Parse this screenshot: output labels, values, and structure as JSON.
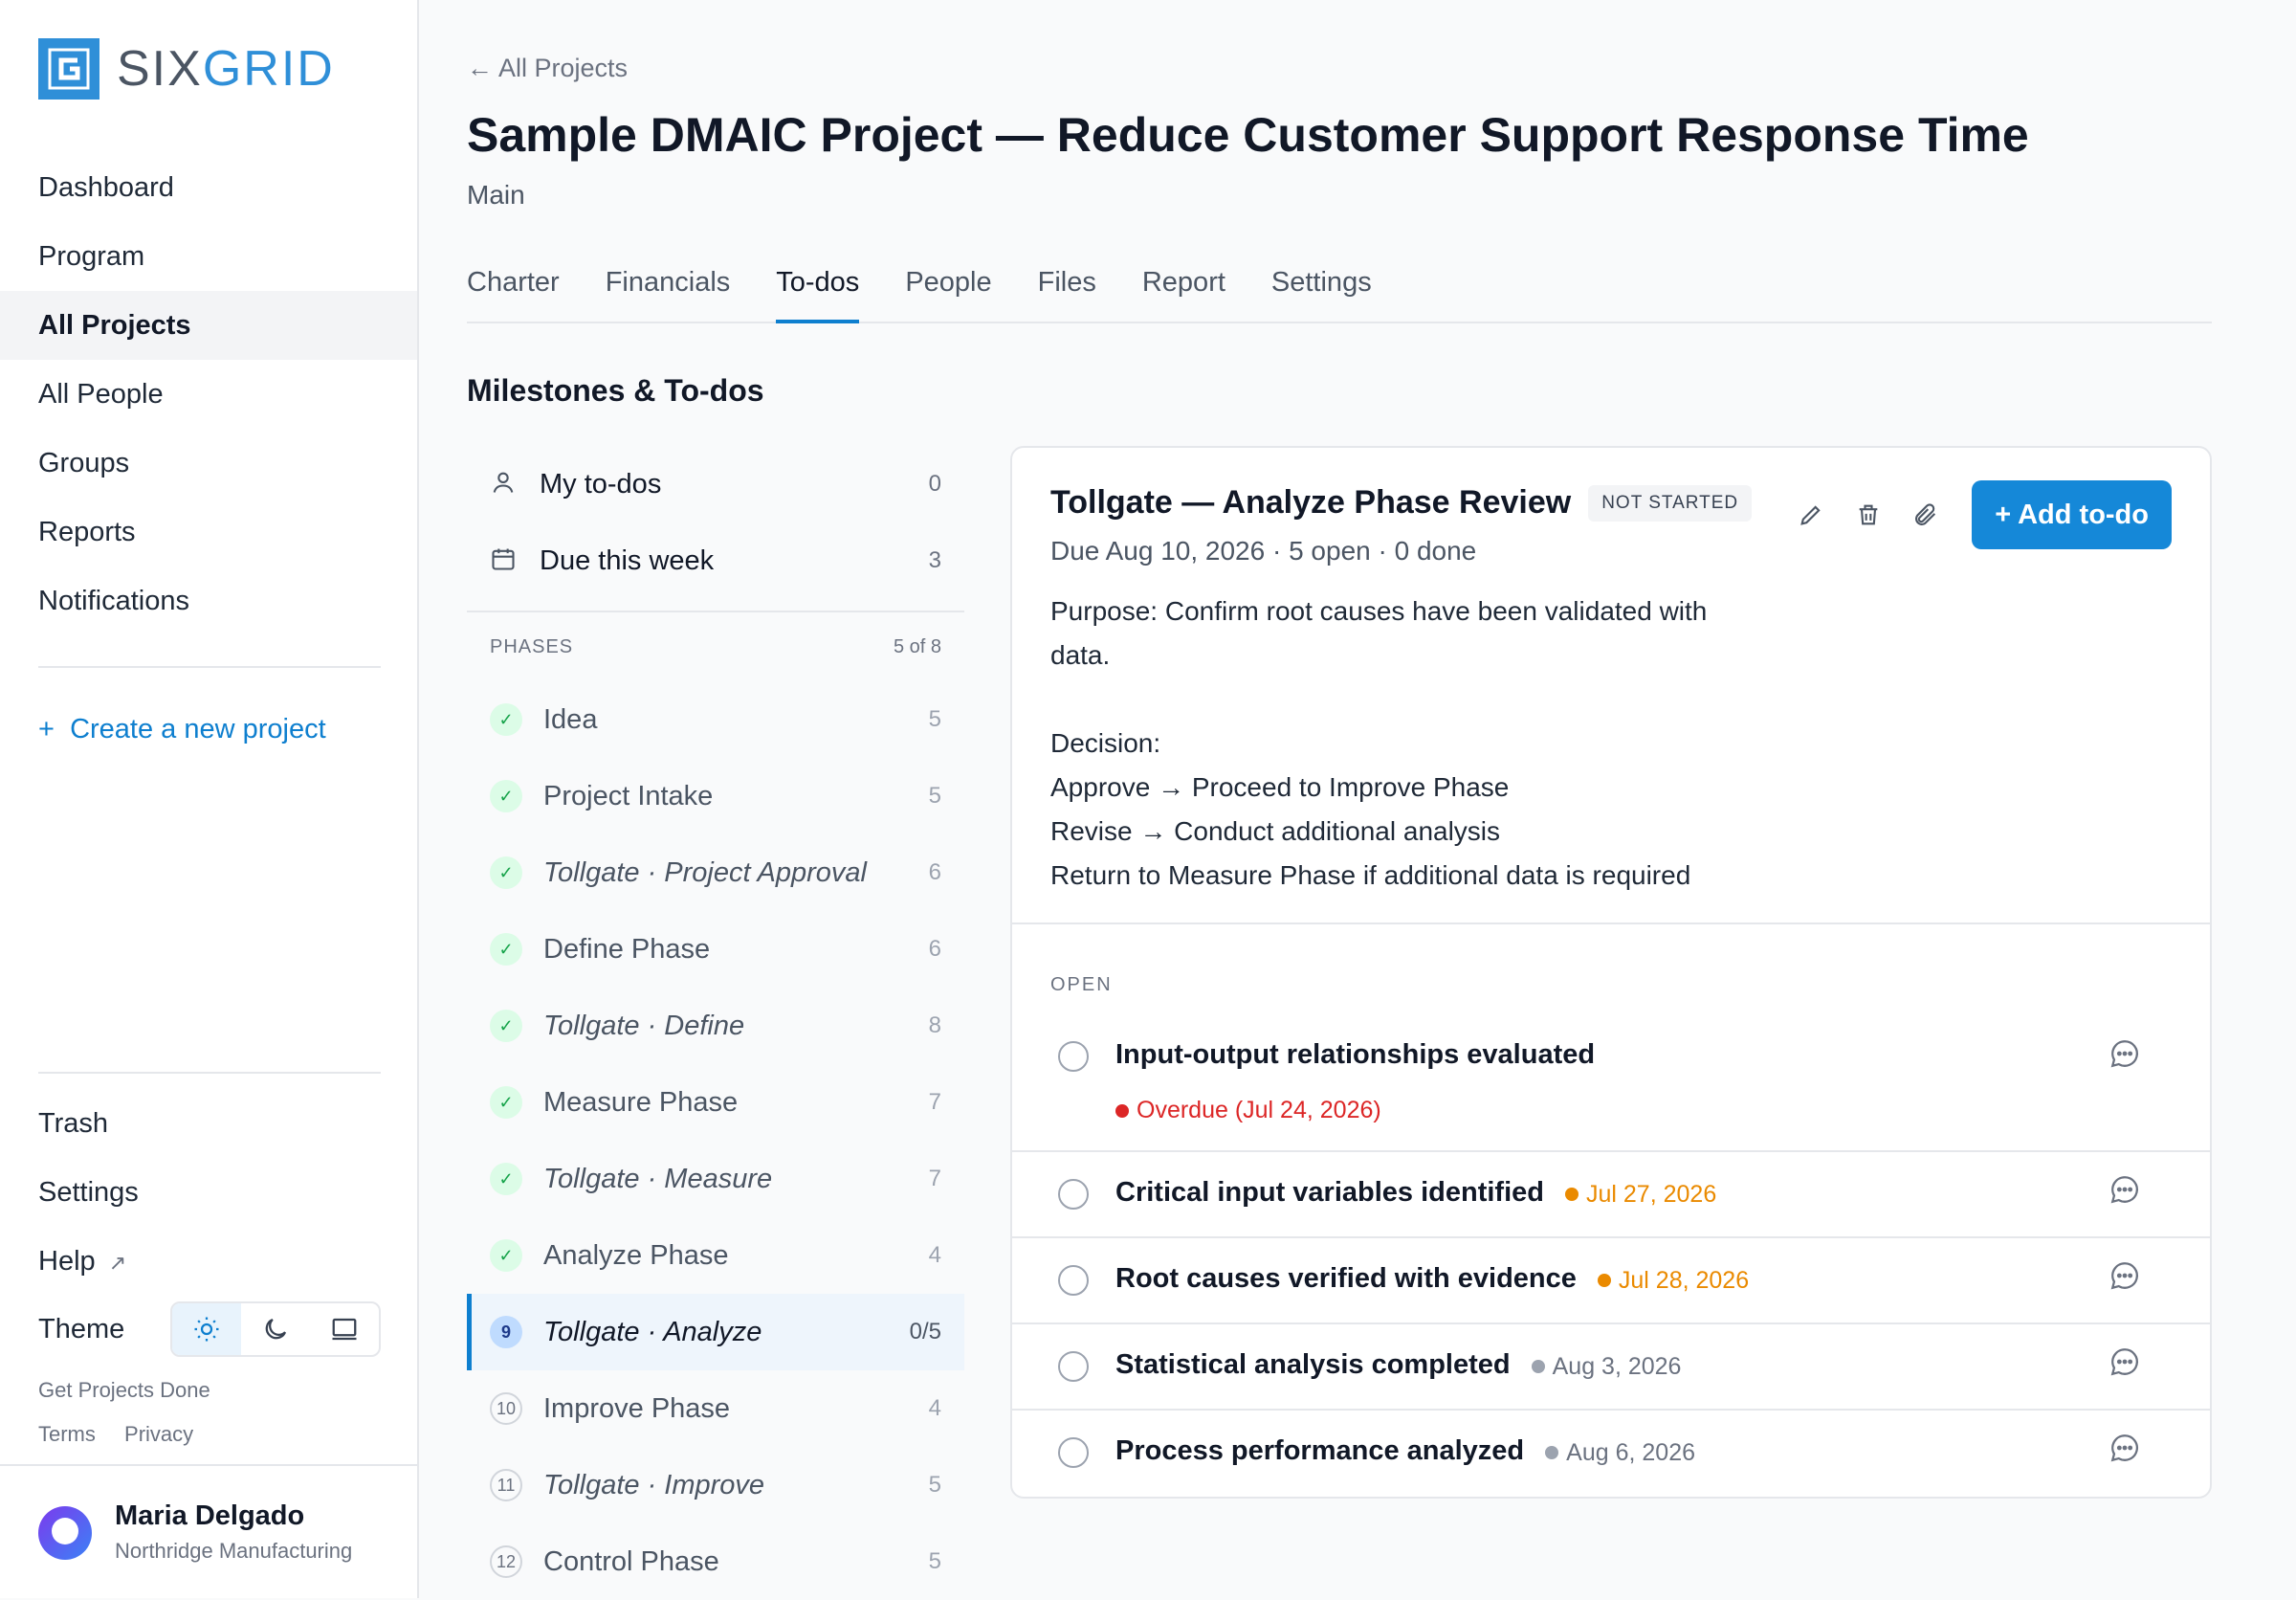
{
  "app": {
    "logo_text_a": "SIX",
    "logo_text_b": "GRID",
    "brand_color": "#2f8fd8"
  },
  "sidebar": {
    "items": [
      {
        "label": "Dashboard"
      },
      {
        "label": "Program"
      },
      {
        "label": "All Projects",
        "active": true
      },
      {
        "label": "All People"
      },
      {
        "label": "Groups"
      },
      {
        "label": "Reports"
      },
      {
        "label": "Notifications"
      }
    ],
    "create_label": "Create a new project",
    "create_icon": "plus-icon",
    "bottom": {
      "trash": "Trash",
      "settings": "Settings",
      "help": "Help",
      "theme": "Theme"
    },
    "theme_options": [
      "sun-icon",
      "moon-icon",
      "monitor-icon"
    ],
    "tagline": "Get Projects Done",
    "terms": "Terms",
    "privacy": "Privacy",
    "user": {
      "name": "Maria Delgado",
      "org": "Northridge Manufacturing"
    }
  },
  "header": {
    "back": "All Projects",
    "title": "Sample DMAIC Project — Reduce Customer Support Response Time",
    "subtitle": "Main",
    "tabs": [
      "Charter",
      "Financials",
      "To-dos",
      "People",
      "Files",
      "Report",
      "Settings"
    ],
    "active_tab": "To-dos"
  },
  "milestones": {
    "title": "Milestones & To-dos",
    "quick": [
      {
        "label": "My to-dos",
        "count": "0",
        "icon": "person-icon"
      },
      {
        "label": "Due this week",
        "count": "3",
        "icon": "calendar-icon"
      }
    ],
    "phases_label": "PHASES",
    "phases_count": "5 of 8",
    "phases": [
      {
        "badge": "✓",
        "label": "Idea",
        "count": "5",
        "state": "done",
        "italic": false
      },
      {
        "badge": "✓",
        "label": "Project Intake",
        "count": "5",
        "state": "done",
        "italic": false
      },
      {
        "badge": "✓",
        "label": "Tollgate · Project Approval",
        "count": "6",
        "state": "done",
        "italic": true
      },
      {
        "badge": "✓",
        "label": "Define Phase",
        "count": "6",
        "state": "done",
        "italic": false
      },
      {
        "badge": "✓",
        "label": "Tollgate · Define",
        "count": "8",
        "state": "done",
        "italic": true
      },
      {
        "badge": "✓",
        "label": "Measure Phase",
        "count": "7",
        "state": "done",
        "italic": false
      },
      {
        "badge": "✓",
        "label": "Tollgate · Measure",
        "count": "7",
        "state": "done",
        "italic": true
      },
      {
        "badge": "✓",
        "label": "Analyze Phase",
        "count": "4",
        "state": "done",
        "italic": false
      },
      {
        "badge": "9",
        "label": "Tollgate · Analyze",
        "count": "0/5",
        "state": "current",
        "italic": true
      },
      {
        "badge": "10",
        "label": "Improve Phase",
        "count": "4",
        "state": "pending",
        "italic": false
      },
      {
        "badge": "11",
        "label": "Tollgate · Improve",
        "count": "5",
        "state": "pending",
        "italic": true
      },
      {
        "badge": "12",
        "label": "Control Phase",
        "count": "5",
        "state": "pending",
        "italic": false
      }
    ]
  },
  "detail": {
    "title": "Tollgate — Analyze Phase Review",
    "status": "NOT STARTED",
    "meta": "Due Aug 10, 2026 · 5 open · 0 done",
    "description": "Purpose: Confirm root causes have been validated with data.\n\nDecision:\nApprove → Proceed to Improve Phase\nRevise → Conduct additional analysis\nReturn to Measure Phase if additional data is required",
    "add_label": "+ Add to-do",
    "action_icons": [
      "pencil-icon",
      "trash-icon",
      "paperclip-icon"
    ],
    "open_label": "OPEN",
    "todos": [
      {
        "title": "Input-output relationships evaluated",
        "date": "Overdue (Jul 24, 2026)",
        "color": "#dc2626",
        "below": true
      },
      {
        "title": "Critical input variables identified",
        "date": "Jul 27, 2026",
        "color": "#ea8a00",
        "below": false
      },
      {
        "title": "Root causes verified with evidence",
        "date": "Jul 28, 2026",
        "color": "#ea8a00",
        "below": false
      },
      {
        "title": "Statistical analysis completed",
        "date": "Aug 3, 2026",
        "color": "#9ca3af",
        "below": false
      },
      {
        "title": "Process performance analyzed",
        "date": "Aug 6, 2026",
        "color": "#9ca3af",
        "below": false
      }
    ]
  }
}
